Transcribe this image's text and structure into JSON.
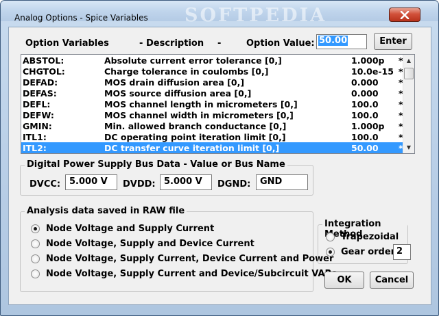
{
  "window": {
    "title": "Analog Options - Spice Variables",
    "watermark": "SOFTPEDIA"
  },
  "header": {
    "col_variables": "Option Variables",
    "sep1": "-",
    "col_description": "Description",
    "sep2": "-",
    "col_value": "Option Value:",
    "value_input": "50.00",
    "enter_label": "Enter"
  },
  "variables": [
    {
      "name": "ABSTOL:",
      "desc": "Absolute current error tolerance [0,]",
      "value": "1.000p",
      "mark": "*"
    },
    {
      "name": "CHGTOL:",
      "desc": "Charge tolerance in coulombs [0,]",
      "value": "10.0e-15",
      "mark": "*"
    },
    {
      "name": "DEFAD:",
      "desc": "MOS drain diffusion area [0,]",
      "value": "0.000",
      "mark": "*"
    },
    {
      "name": "DEFAS:",
      "desc": "MOS source diffusion area [0,]",
      "value": "0.000",
      "mark": "*"
    },
    {
      "name": "DEFL:",
      "desc": "MOS channel length in micrometers [0,]",
      "value": "100.0",
      "mark": "*"
    },
    {
      "name": "DEFW:",
      "desc": "MOS channel width in micrometers [0,]",
      "value": "100.0",
      "mark": "*"
    },
    {
      "name": "GMIN:",
      "desc": "Min. allowed branch conductance [0,]",
      "value": "1.000p",
      "mark": "*"
    },
    {
      "name": "ITL1:",
      "desc": "DC operating point iteration limit [0,]",
      "value": "100.0",
      "mark": "*"
    },
    {
      "name": "ITL2:",
      "desc": "DC transfer curve iteration limit [0,]",
      "value": "50.00",
      "mark": "*",
      "selected": true
    }
  ],
  "power": {
    "group_title": "Digital Power Supply Bus Data - Value or Bus Name",
    "dvcc_label": "DVCC:",
    "dvcc_value": "5.000 V",
    "dvdd_label": "DVDD:",
    "dvdd_value": "5.000 V",
    "dgnd_label": "DGND:",
    "dgnd_value": "GND"
  },
  "raw": {
    "group_title": "Analysis data saved in RAW file",
    "options": [
      {
        "label": "Node Voltage and Supply Current",
        "checked": true
      },
      {
        "label": "Node Voltage, Supply and Device Current",
        "checked": false
      },
      {
        "label": "Node Voltage, Supply Current, Device Current and Power",
        "checked": false
      },
      {
        "label": "Node Voltage, Supply Current and Device/Subcircuit VARs",
        "checked": false
      }
    ]
  },
  "integration": {
    "group_title": "Integration Method",
    "trapezoidal_label": "Trapezoidal",
    "gear_label": "Gear order:",
    "gear_value": "2",
    "selected": "gear"
  },
  "buttons": {
    "ok": "OK",
    "cancel": "Cancel"
  },
  "colors": {
    "selection": "#3399ff",
    "close_button": "#c8442d"
  }
}
